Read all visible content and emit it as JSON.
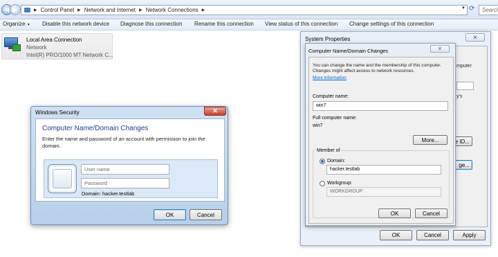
{
  "address_bar": {
    "segments": [
      "Control Panel",
      "Network and Internet",
      "Network Connections"
    ],
    "search_placeholder": "Search"
  },
  "toolbar": {
    "organize": "Organize",
    "items": [
      "Disable this network device",
      "Diagnose this connection",
      "Rename this connection",
      "View status of this connection",
      "Change settings of this connection"
    ]
  },
  "connection": {
    "name": "Local Area Connection",
    "status": "Network",
    "adapter": "Intel(R) PRO/1000 MT Network C..."
  },
  "system_properties": {
    "title": "System Properties",
    "partial_right_text": [
      "mputer",
      "y's",
      "e ID...",
      "ge..."
    ],
    "ok": "OK",
    "cancel": "Cancel",
    "apply": "Apply"
  },
  "name_changes": {
    "title": "Computer Name/Domain Changes",
    "description": "You can change the name and the membership of this computer. Changes might affect access to network resources.",
    "more_info": "More information",
    "computer_name_label": "Computer name:",
    "computer_name": "win7",
    "full_name_label": "Full computer name:",
    "full_name": "win7",
    "more_button": "More...",
    "member_of": "Member of",
    "domain_label": "Domain:",
    "domain_value": "hacker.testlab",
    "workgroup_label": "Workgroup:",
    "workgroup_value": "WORKGROUP",
    "ok": "OK",
    "cancel": "Cancel"
  },
  "security": {
    "title": "Windows Security",
    "heading": "Computer Name/Domain Changes",
    "description": "Enter the name and password of an account with permission to join the domain.",
    "username_placeholder": "User name",
    "password_placeholder": "Password",
    "domain_text": "Domain: hacker.testlab",
    "ok": "OK",
    "cancel": "Cancel",
    "close": "✕"
  }
}
